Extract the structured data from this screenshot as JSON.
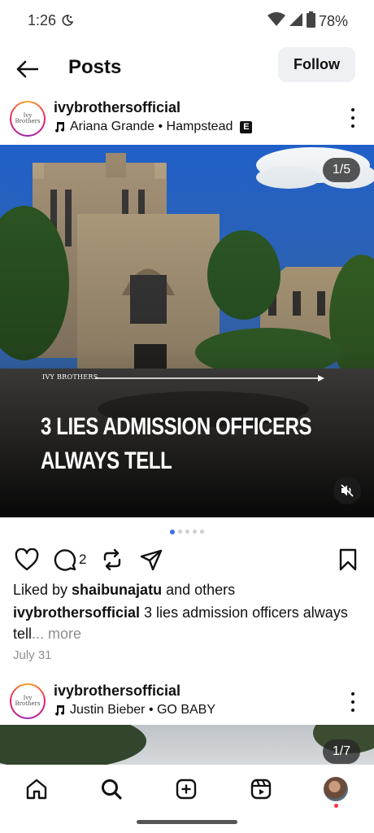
{
  "status_bar": {
    "time": "1:26",
    "battery": "78%",
    "icons": [
      "do-not-disturb-moon-icon",
      "wifi-icon",
      "cell-signal-icon",
      "battery-icon"
    ]
  },
  "header": {
    "title": "Posts",
    "follow_label": "Follow"
  },
  "posts": [
    {
      "avatar_text": "Ivy Brothers",
      "username": "ivybrothersofficial",
      "music": "Ariana Grande • Hampstead",
      "explicit_badge": "E",
      "counter": "1/5",
      "overlay": {
        "brand": "IVY BROTHERS",
        "headline_line1": "3 LIES ADMISSION OFFICERS",
        "headline_line2": "ALWAYS TELL"
      },
      "carousel": {
        "total": 5,
        "active_index": 0
      },
      "comment_count": "2",
      "liked_prefix": "Liked by ",
      "liked_user": "shaibunajatu",
      "liked_suffix": " and others",
      "caption_user": "ivybrothersofficial",
      "caption_text": " 3 lies admission officers always tell",
      "caption_more": "... more",
      "date": "July 31"
    },
    {
      "avatar_text": "Ivy Brothers",
      "username": "ivybrothersofficial",
      "music": "Justin Bieber • GO BABY",
      "counter": "1/7"
    }
  ],
  "bottom_nav": [
    "home-icon",
    "search-icon",
    "create-post-icon",
    "reels-icon",
    "profile-avatar"
  ],
  "colors": {
    "accent_blue": "#3f6fe8",
    "follow_bg": "#eef0f3",
    "secondary_text": "#8e8e8e",
    "notification": "#ff3040"
  }
}
